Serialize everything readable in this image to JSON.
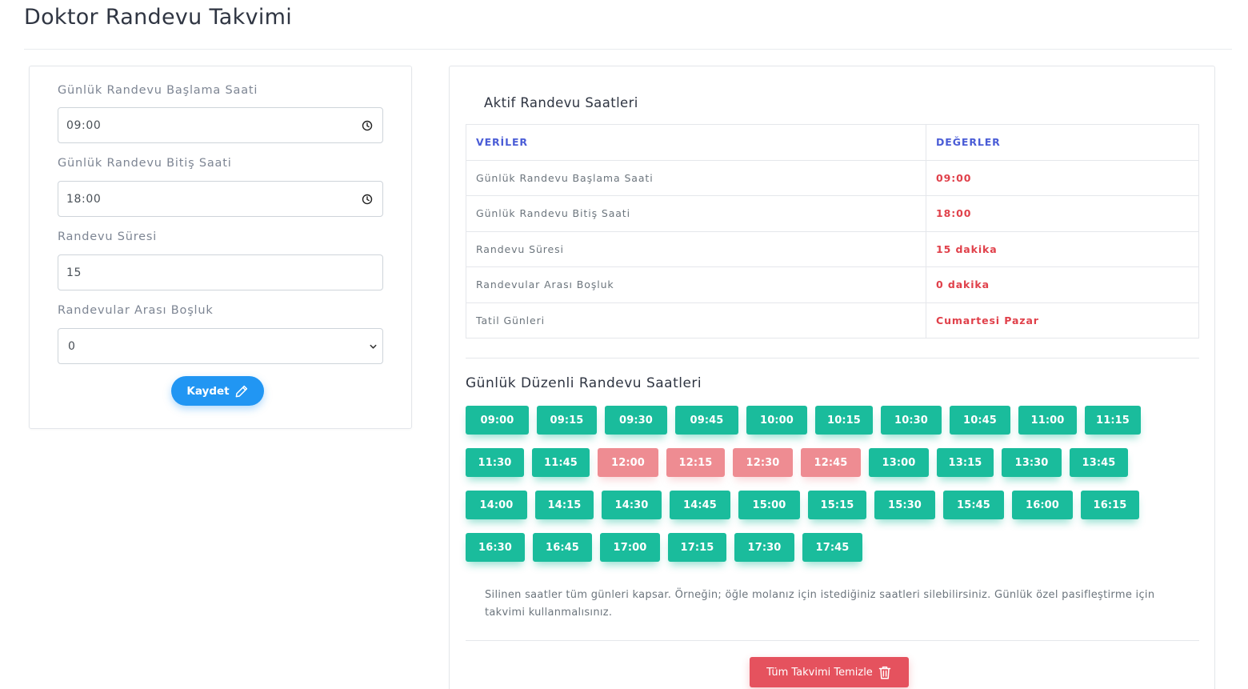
{
  "page": {
    "title": "Doktor Randevu Takvimi"
  },
  "form": {
    "start": {
      "label": "Günlük Randevu Başlama Saati",
      "value": "09:00"
    },
    "end": {
      "label": "Günlük Randevu Bitiş Saati",
      "value": "18:00"
    },
    "duration": {
      "label": "Randevu Süresi",
      "value": "15"
    },
    "gap": {
      "label": "Randevular Arası Boşluk",
      "value": "0"
    },
    "save_label": "Kaydet",
    "icons": {
      "time": "clock-icon",
      "select": "chevron-down-icon",
      "save": "pencil-icon"
    }
  },
  "active": {
    "title": "Aktif Randevu Saatleri",
    "headers": [
      "VERİLER",
      "DEĞERLER"
    ],
    "rows": [
      {
        "key": "Günlük Randevu Başlama Saati",
        "value": "09:00"
      },
      {
        "key": "Günlük Randevu Bitiş Saati",
        "value": "18:00"
      },
      {
        "key": "Randevu Süresi",
        "value": "15 dakika"
      },
      {
        "key": "Randevular Arası Boşluk",
        "value": "0 dakika"
      },
      {
        "key": "Tatil Günleri",
        "value": "Cumartesi Pazar"
      }
    ]
  },
  "slots": {
    "title": "Günlük Düzenli Randevu Saatleri",
    "items": [
      {
        "time": "09:00",
        "status": "active"
      },
      {
        "time": "09:15",
        "status": "active"
      },
      {
        "time": "09:30",
        "status": "active"
      },
      {
        "time": "09:45",
        "status": "active"
      },
      {
        "time": "10:00",
        "status": "active"
      },
      {
        "time": "10:15",
        "status": "active"
      },
      {
        "time": "10:30",
        "status": "active"
      },
      {
        "time": "10:45",
        "status": "active"
      },
      {
        "time": "11:00",
        "status": "active"
      },
      {
        "time": "11:15",
        "status": "active"
      },
      {
        "time": "11:30",
        "status": "active"
      },
      {
        "time": "11:45",
        "status": "active"
      },
      {
        "time": "12:00",
        "status": "passive"
      },
      {
        "time": "12:15",
        "status": "passive"
      },
      {
        "time": "12:30",
        "status": "passive"
      },
      {
        "time": "12:45",
        "status": "passive"
      },
      {
        "time": "13:00",
        "status": "active"
      },
      {
        "time": "13:15",
        "status": "active"
      },
      {
        "time": "13:30",
        "status": "active"
      },
      {
        "time": "13:45",
        "status": "active"
      },
      {
        "time": "14:00",
        "status": "active"
      },
      {
        "time": "14:15",
        "status": "active"
      },
      {
        "time": "14:30",
        "status": "active"
      },
      {
        "time": "14:45",
        "status": "active"
      },
      {
        "time": "15:00",
        "status": "active"
      },
      {
        "time": "15:15",
        "status": "active"
      },
      {
        "time": "15:30",
        "status": "active"
      },
      {
        "time": "15:45",
        "status": "active"
      },
      {
        "time": "16:00",
        "status": "active"
      },
      {
        "time": "16:15",
        "status": "active"
      },
      {
        "time": "16:30",
        "status": "active"
      },
      {
        "time": "16:45",
        "status": "active"
      },
      {
        "time": "17:00",
        "status": "active"
      },
      {
        "time": "17:15",
        "status": "active"
      },
      {
        "time": "17:30",
        "status": "active"
      },
      {
        "time": "17:45",
        "status": "active"
      }
    ],
    "note": "Silinen saatler tüm günleri kapsar. Örneğin; öğle molanız için istediğiniz saatleri silebilirsiniz. Günlük özel pasifleştirme için takvimi kullanmalısınız."
  },
  "clear_button": {
    "label": "Tüm Takvimi Temizle",
    "icon": "trash-icon"
  },
  "colors": {
    "active_slot": "#1abc9c",
    "passive_slot": "#ee8c92",
    "primary": "#2196f3",
    "danger": "#e5525e",
    "value_text": "#e0404a",
    "header_text": "#4a5cd6"
  }
}
